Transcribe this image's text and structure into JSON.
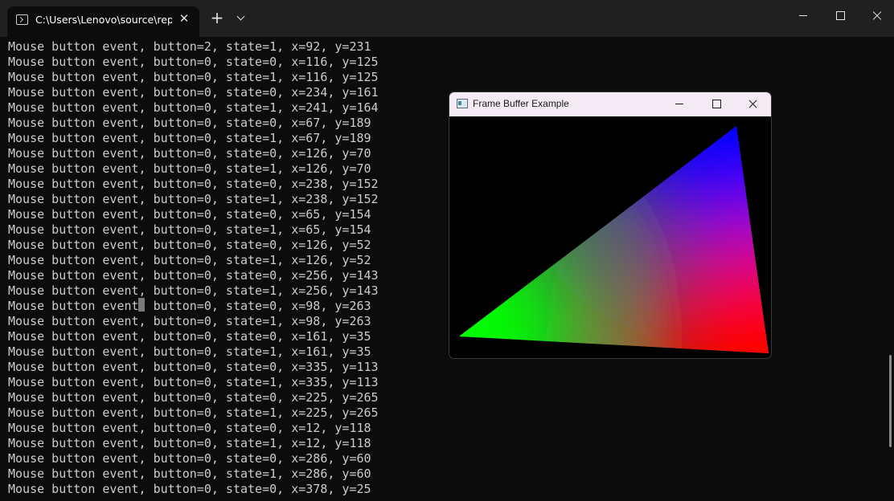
{
  "terminal_window": {
    "tab_title": "C:\\Users\\Lenovo\\source\\repo",
    "tab_icon": "terminal-icon",
    "new_tab_label": "+",
    "close_tab_label": "✕"
  },
  "terminal_output": {
    "lines": [
      "Mouse button event, button=2, state=1, x=92, y=231",
      "Mouse button event, button=0, state=0, x=116, y=125",
      "Mouse button event, button=0, state=1, x=116, y=125",
      "Mouse button event, button=0, state=0, x=234, y=161",
      "Mouse button event, button=0, state=1, x=241, y=164",
      "Mouse button event, button=0, state=0, x=67, y=189",
      "Mouse button event, button=0, state=1, x=67, y=189",
      "Mouse button event, button=0, state=0, x=126, y=70",
      "Mouse button event, button=0, state=1, x=126, y=70",
      "Mouse button event, button=0, state=0, x=238, y=152",
      "Mouse button event, button=0, state=1, x=238, y=152",
      "Mouse button event, button=0, state=0, x=65, y=154",
      "Mouse button event, button=0, state=1, x=65, y=154",
      "Mouse button event, button=0, state=0, x=126, y=52",
      "Mouse button event, button=0, state=1, x=126, y=52",
      "Mouse button event, button=0, state=0, x=256, y=143",
      "Mouse button event, button=0, state=1, x=256, y=143",
      "Mouse button event, button=0, state=0, x=98, y=263",
      "Mouse button event, button=0, state=1, x=98, y=263",
      "Mouse button event, button=0, state=0, x=161, y=35",
      "Mouse button event, button=0, state=1, x=161, y=35",
      "Mouse button event, button=0, state=0, x=335, y=113",
      "Mouse button event, button=0, state=1, x=335, y=113",
      "Mouse button event, button=0, state=0, x=225, y=265",
      "Mouse button event, button=0, state=1, x=225, y=265",
      "Mouse button event, button=0, state=0, x=12, y=118",
      "Mouse button event, button=0, state=1, x=12, y=118",
      "Mouse button event, button=0, state=0, x=286, y=60",
      "Mouse button event, button=0, state=1, x=286, y=60",
      "Mouse button event, button=0, state=0, x=378, y=25"
    ]
  },
  "frame_buffer_window": {
    "title": "Frame Buffer Example",
    "icon": "app-window-icon",
    "triangle_colors": [
      "#ff0000",
      "#00ff00",
      "#0000ff"
    ]
  },
  "colors": {
    "terminal_bg": "#0c0c0c",
    "terminal_text": "#cccccc",
    "titlebar_bg": "#202020",
    "fb_titlebar_bg": "#f3eaf3"
  }
}
